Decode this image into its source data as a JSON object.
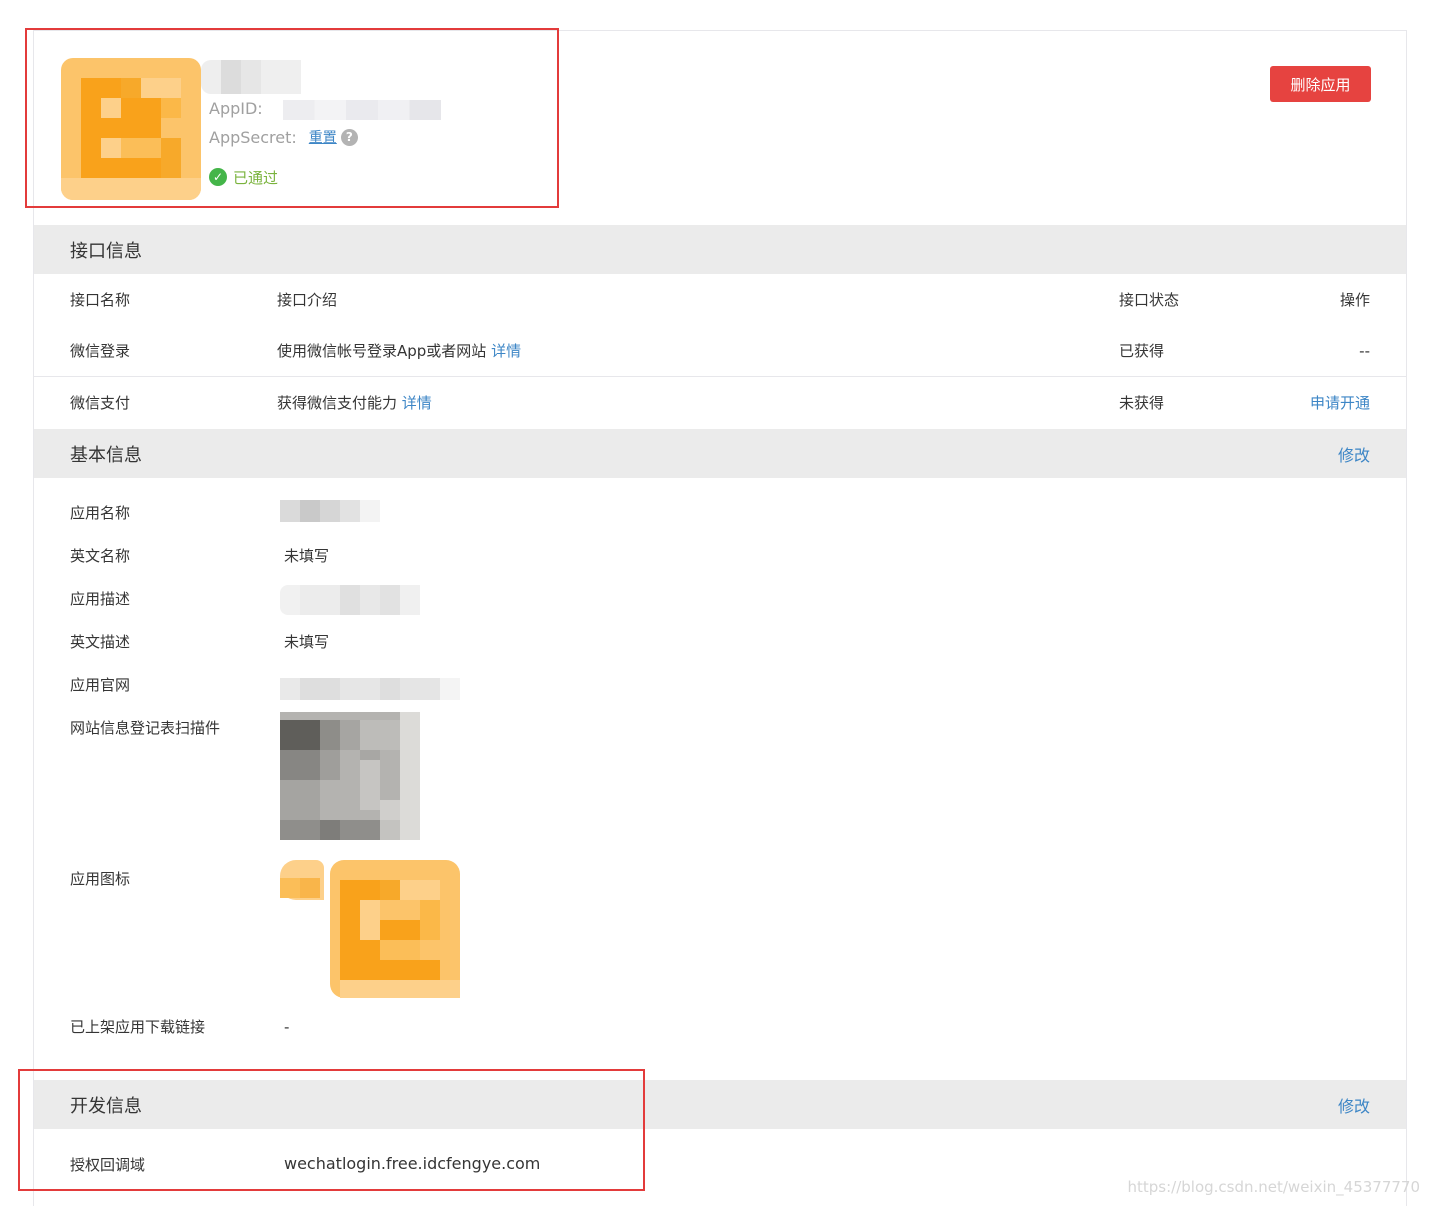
{
  "header": {
    "appid_label": "AppID:",
    "appsecret_label": "AppSecret:",
    "reset_link": "重置",
    "help_icon": "?",
    "status_icon": "✓",
    "status": "已通过",
    "delete_button": "删除应用"
  },
  "interface_section": {
    "title": "接口信息",
    "columns": [
      "接口名称",
      "接口介绍",
      "接口状态",
      "操作"
    ],
    "rows": [
      {
        "name": "微信登录",
        "desc": "使用微信帐号登录App或者网站",
        "detail": "详情",
        "status": "已获得",
        "action": "--"
      },
      {
        "name": "微信支付",
        "desc": "获得微信支付能力",
        "detail": "详情",
        "status": "未获得",
        "action": "申请开通"
      }
    ]
  },
  "basic_section": {
    "title": "基本信息",
    "edit": "修改",
    "fields": [
      {
        "label": "应用名称",
        "value": ""
      },
      {
        "label": "英文名称",
        "value": "未填写"
      },
      {
        "label": "应用描述",
        "value": ""
      },
      {
        "label": "英文描述",
        "value": "未填写"
      },
      {
        "label": "应用官网",
        "value": ""
      },
      {
        "label": "网站信息登记表扫描件",
        "value": ""
      },
      {
        "label": "应用图标",
        "value": ""
      },
      {
        "label": "已上架应用下载链接",
        "value": "-"
      }
    ]
  },
  "dev_section": {
    "title": "开发信息",
    "edit": "修改",
    "callback_label": "授权回调域",
    "callback_value": "wechatlogin.free.idcfengye.com"
  },
  "watermark": "https://blog.csdn.net/weixin_45377770",
  "colors": {
    "accent_link": "#3d86c6",
    "danger": "#e64340",
    "success": "#44b549",
    "highlight_box": "#e33b3b",
    "section_bg": "#ebebeb"
  }
}
